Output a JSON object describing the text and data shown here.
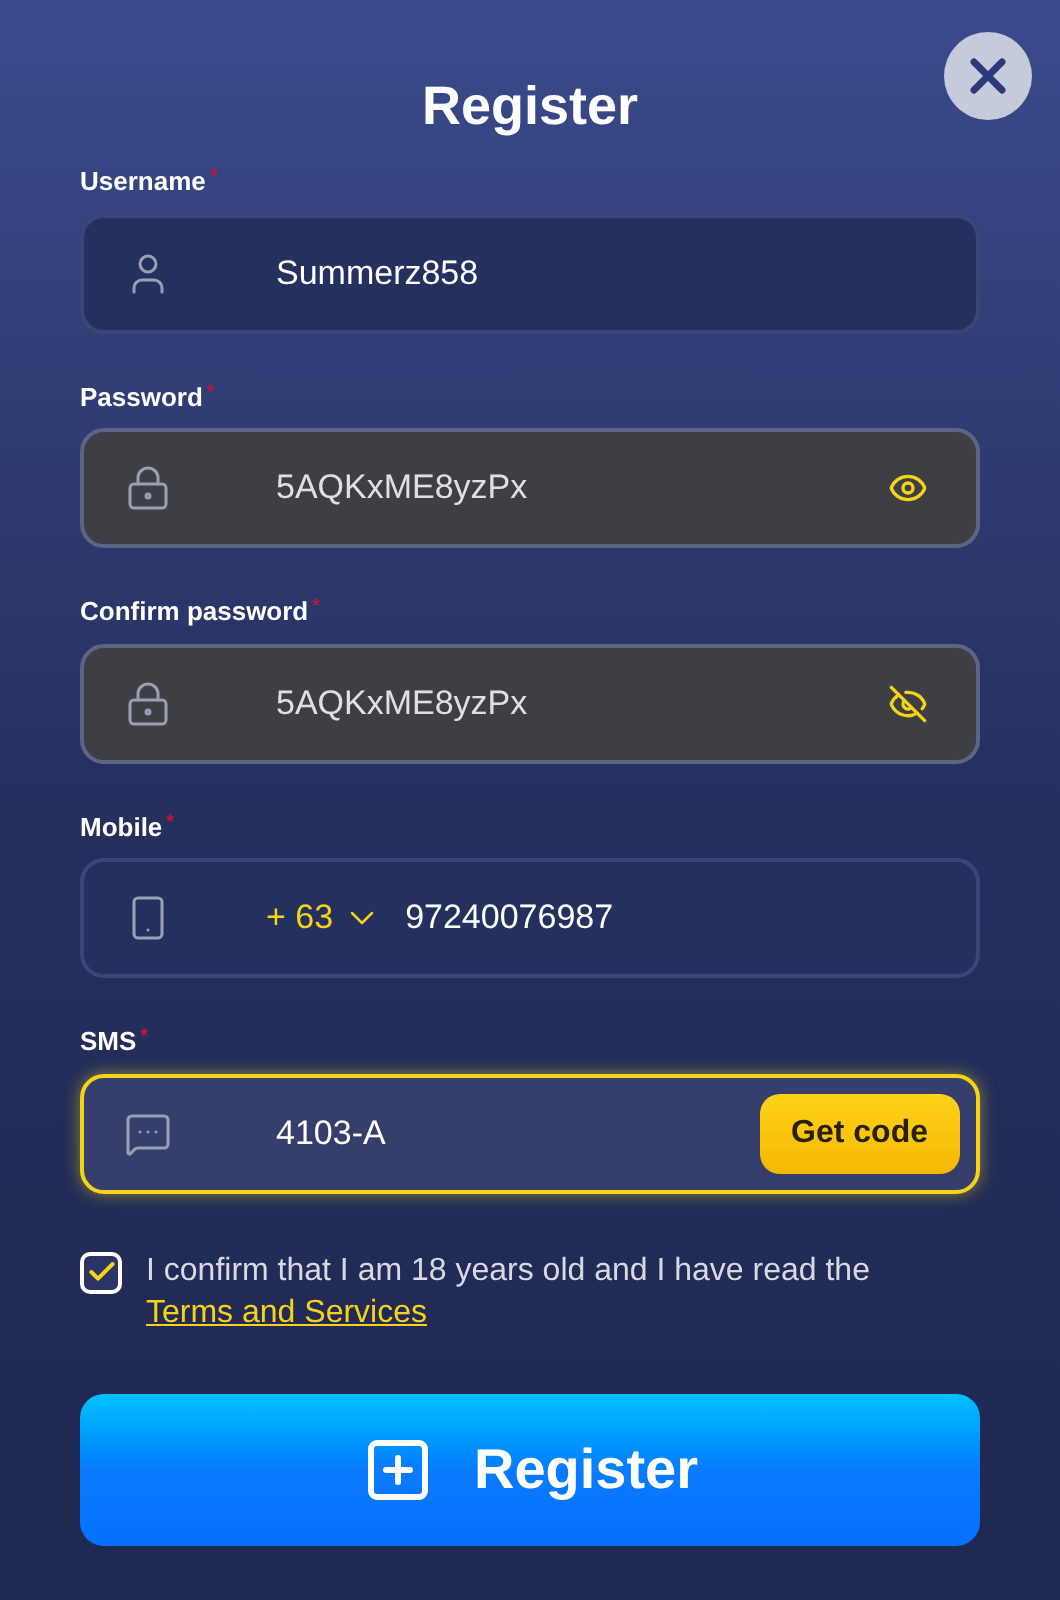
{
  "title": "Register",
  "fields": [
    {
      "kind": "username",
      "label": "Username",
      "required_mark": "*",
      "value": "Summerz858",
      "autofilled": false,
      "focused": false
    },
    {
      "kind": "password",
      "label": "Password",
      "required_mark": "*",
      "value": "5AQKxME8yzPx",
      "autofilled": true,
      "focused": false,
      "revealed": true
    },
    {
      "kind": "password",
      "label": "Confirm password",
      "required_mark": "*",
      "value": "5AQKxME8yzPx",
      "autofilled": true,
      "focused": false,
      "revealed": false
    },
    {
      "kind": "mobile",
      "label": "Mobile",
      "required_mark": "*",
      "country_code": "+ 63",
      "value": "97240076987",
      "autofilled": false,
      "focused": false
    },
    {
      "kind": "sms",
      "label": "SMS",
      "required_mark": "*",
      "value": "4103-A",
      "autofilled": false,
      "focused": true,
      "button": "Get code"
    }
  ],
  "consent": {
    "checked": true,
    "text": "I confirm that I am 18 years old and I have read the",
    "link": "Terms and Services"
  },
  "submit": "Register"
}
